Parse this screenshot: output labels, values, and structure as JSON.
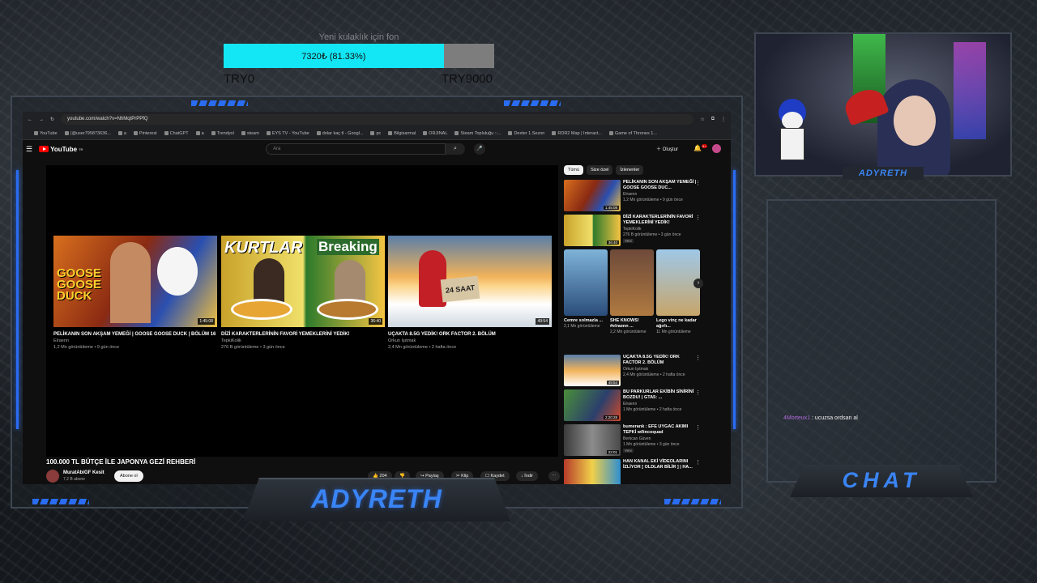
{
  "goal": {
    "title": "Yeni kulaklık için fon",
    "progress_text": "7320₺ (81.33%)",
    "progress_fraction": 0.8133,
    "min_label": "TRY0",
    "max_label": "TRY9000"
  },
  "browser": {
    "url": "youtube.com/watch?v=NhMqtPrPPfQ",
    "bookmarks": [
      "YouTube",
      "(@user795873636...",
      "a",
      "Pinterest",
      "ChatGPT",
      "a",
      "Trendyol",
      "steam",
      "EYS TV - YouTube",
      "dolar kaç tl - Googl...",
      "pc",
      "Bilgisarmal",
      "ORJINAL",
      "Steam Topluluğu ::...",
      "Dexter 1.Sezon",
      "RDR2 Map | Interact...",
      "Game of Thrones 1..."
    ]
  },
  "youtube": {
    "logo": "YouTube",
    "logo_region": "TR",
    "search_placeholder": "Ara",
    "create_label": "Oluştur",
    "bell_count": "9+",
    "end_cards": [
      {
        "title": "PELİKANIN SON AKŞAM YEMEĞİ | GOOSE GOOSE DUCK | BÖLÜM 16",
        "channel": "Elraenn",
        "meta": "1,2 Mn görüntüleme • 9 gün önce",
        "duration": "1:45:08"
      },
      {
        "title": "DİZİ KARAKTERLERİNİN FAVORİ YEMEKLERİNİ YEDİK!",
        "channel": "TepkiKolik",
        "meta": "276 B görüntüleme • 3 gün önce",
        "duration": "36:40"
      },
      {
        "title": "UÇAKTA 8.5G YEDİK! ORK FACTOR 2. BÖLÜM",
        "channel": "Orkun Işıtmak",
        "meta": "2,4 Mn görüntüleme • 2 hafta önce",
        "duration": "49:54"
      }
    ],
    "video_title": "100.000 TL BÜTÇE İLE JAPONYA GEZİ REHBERİ",
    "channel_name": "MuratAbiGF Kesit",
    "channel_subs": "7,2 B abone",
    "subscribe_label": "Abone ol",
    "like_count": "204",
    "share_label": "Paylaş",
    "clip_label": "Klip",
    "save_label": "Kaydet",
    "download_label": "İndir",
    "chips": [
      "Tümü",
      "Size özel",
      "İzlenenler"
    ],
    "sidebar_top": [
      {
        "title": "PELİKANIN SON AKŞAM YEMEĞİ | GOOSE GOOSE DUC...",
        "channel": "Elraenn",
        "meta": "1,2 Mn görüntüleme • 9 gün önce",
        "duration": "1:45:08"
      },
      {
        "title": "DİZİ KARAKTERLERİNİN FAVORİ YEMEKLERİNİ YEDİK!",
        "channel": "TepkiKolik",
        "meta": "276 B görüntüleme • 3 gün önce",
        "duration": "36:40",
        "badge": "Yeni"
      }
    ],
    "shorts": [
      {
        "title": "Cemre solmazla ...",
        "meta": "2,1 Mn görüntüleme"
      },
      {
        "title": "SHE KNOWS! #elraenn ...",
        "meta": "2,2 Mn görüntüleme"
      },
      {
        "title": "Lego vinç ne kadar ağırlı...",
        "meta": "11 Mn görüntüleme"
      }
    ],
    "sidebar_bottom": [
      {
        "title": "UÇAKTA 8.5G YEDİK! ORK FACTOR 2. BÖLÜM",
        "channel": "Orkun Işıtmak",
        "meta": "2,4 Mn görüntüleme • 2 hafta önce",
        "duration": "49:54"
      },
      {
        "title": "BU PARKURLAR EKİBİN SİNİRİNİ BOZDU! | GTA5: ...",
        "channel": "Elraenn",
        "meta": "1 Mn görüntüleme • 2 hafta önce",
        "duration": "2:20:28"
      },
      {
        "title": "bumerank : EFE UYGAC AKIMI TEPKİ w/lincoquad",
        "channel": "Berkcan Güven",
        "meta": "1 Mn görüntüleme • 3 gün önce",
        "duration": "22:01",
        "badge": "Yeni"
      },
      {
        "title": "HAN KANAL EKİ VİDEOLARINI İZLİYOR [ OLDLAR BİLİR ] | HA...",
        "channel": "",
        "meta": "",
        "duration": ""
      }
    ]
  },
  "overlay": {
    "streamer_name": "ADYRETH",
    "cam_label": "ADYRETH",
    "chat_title": "CHAT",
    "chat_messages": [
      {
        "user": "4Morteux1",
        "text": ": ucuzsa ordsan al"
      }
    ]
  },
  "colors": {
    "accent": "#3a85f5",
    "goal_fill": "#13e7f5",
    "yt_red": "#ff0000"
  }
}
